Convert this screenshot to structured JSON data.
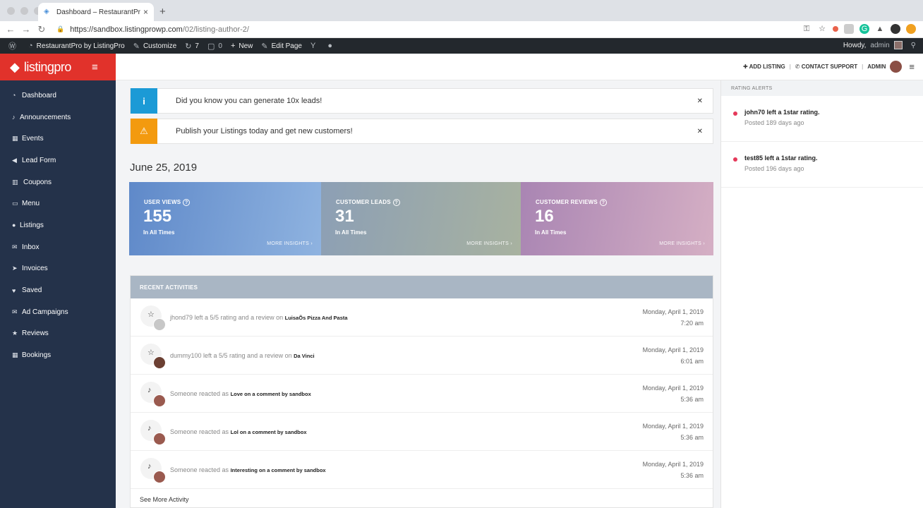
{
  "browser": {
    "tab_title": "Dashboard – RestaurantPro by",
    "url_host": "https://sandbox.listingprowp.com",
    "url_path": "/02/listing-author-2/"
  },
  "wpbar": {
    "site_name": "RestaurantPro by ListingPro",
    "customize": "Customize",
    "updates_count": "7",
    "comments_count": "0",
    "new_label": "New",
    "edit_page": "Edit Page",
    "howdy": "Howdy,",
    "user": "admin"
  },
  "sidebar": {
    "brand": "listingpro",
    "items": [
      {
        "label": "Dashboard",
        "icon": "dashboard-icon"
      },
      {
        "label": "Announcements",
        "icon": "microphone-icon"
      },
      {
        "label": "Events",
        "icon": "calendar-icon"
      },
      {
        "label": "Lead Form",
        "icon": "megaphone-icon"
      },
      {
        "label": "Coupons",
        "icon": "bar-chart-icon"
      },
      {
        "label": "Menu",
        "icon": "card-icon"
      },
      {
        "label": "Listings",
        "icon": "map-pin-icon"
      },
      {
        "label": "Inbox",
        "icon": "envelope-icon"
      },
      {
        "label": "Invoices",
        "icon": "paper-plane-icon"
      },
      {
        "label": "Saved",
        "icon": "heart-icon"
      },
      {
        "label": "Ad Campaigns",
        "icon": "envelope-open-icon"
      },
      {
        "label": "Reviews",
        "icon": "star-icon"
      },
      {
        "label": "Bookings",
        "icon": "calendar-check-icon"
      }
    ]
  },
  "topbar": {
    "add_listing": "ADD LISTING",
    "contact_support": "CONTACT SUPPORT",
    "admin": "ADMIN"
  },
  "notices": [
    {
      "text": "Did you know you can generate 10x leads!",
      "color": "#1b9ad6"
    },
    {
      "text": "Publish your Listings today and get new customers!",
      "color": "#f39a0f"
    }
  ],
  "date": "June 25, 2019",
  "stats": [
    {
      "label": "USER VIEWS",
      "value": "155",
      "sub": "In All Times",
      "more": "MORE INSIGHTS"
    },
    {
      "label": "CUSTOMER LEADS",
      "value": "31",
      "sub": "In All Times",
      "more": "MORE INSIGHTS"
    },
    {
      "label": "CUSTOMER REVIEWS",
      "value": "16",
      "sub": "In All Times",
      "more": "MORE INSIGHTS"
    }
  ],
  "activity": {
    "title": "RECENT ACTIVITIES",
    "rows": [
      {
        "prefix": "jhond79 left a 5/5 rating and a review on",
        "target": "LuisaÕs Pizza And Pasta",
        "date": "Monday, April 1, 2019",
        "time": "7:20 am"
      },
      {
        "prefix": "dummy100 left a 5/5 rating and a review on",
        "target": "Da Vinci",
        "date": "Monday, April 1, 2019",
        "time": "6:01 am"
      },
      {
        "prefix": "Someone reacted as",
        "target": "Love on a comment by sandbox",
        "date": "Monday, April 1, 2019",
        "time": "5:36 am"
      },
      {
        "prefix": "Someone reacted as",
        "target": "Lol on a comment by sandbox",
        "date": "Monday, April 1, 2019",
        "time": "5:36 am"
      },
      {
        "prefix": "Someone reacted as",
        "target": "Interesting on a comment by sandbox",
        "date": "Monday, April 1, 2019",
        "time": "5:36 am"
      }
    ],
    "see_more": "See More Activity"
  },
  "rating_alerts": {
    "title": "RATING ALERTS",
    "items": [
      {
        "title": "john70 left a 1star rating.",
        "sub": "Posted 189 days ago"
      },
      {
        "title": "test85 left a 1star rating.",
        "sub": "Posted 196 days ago"
      }
    ]
  }
}
